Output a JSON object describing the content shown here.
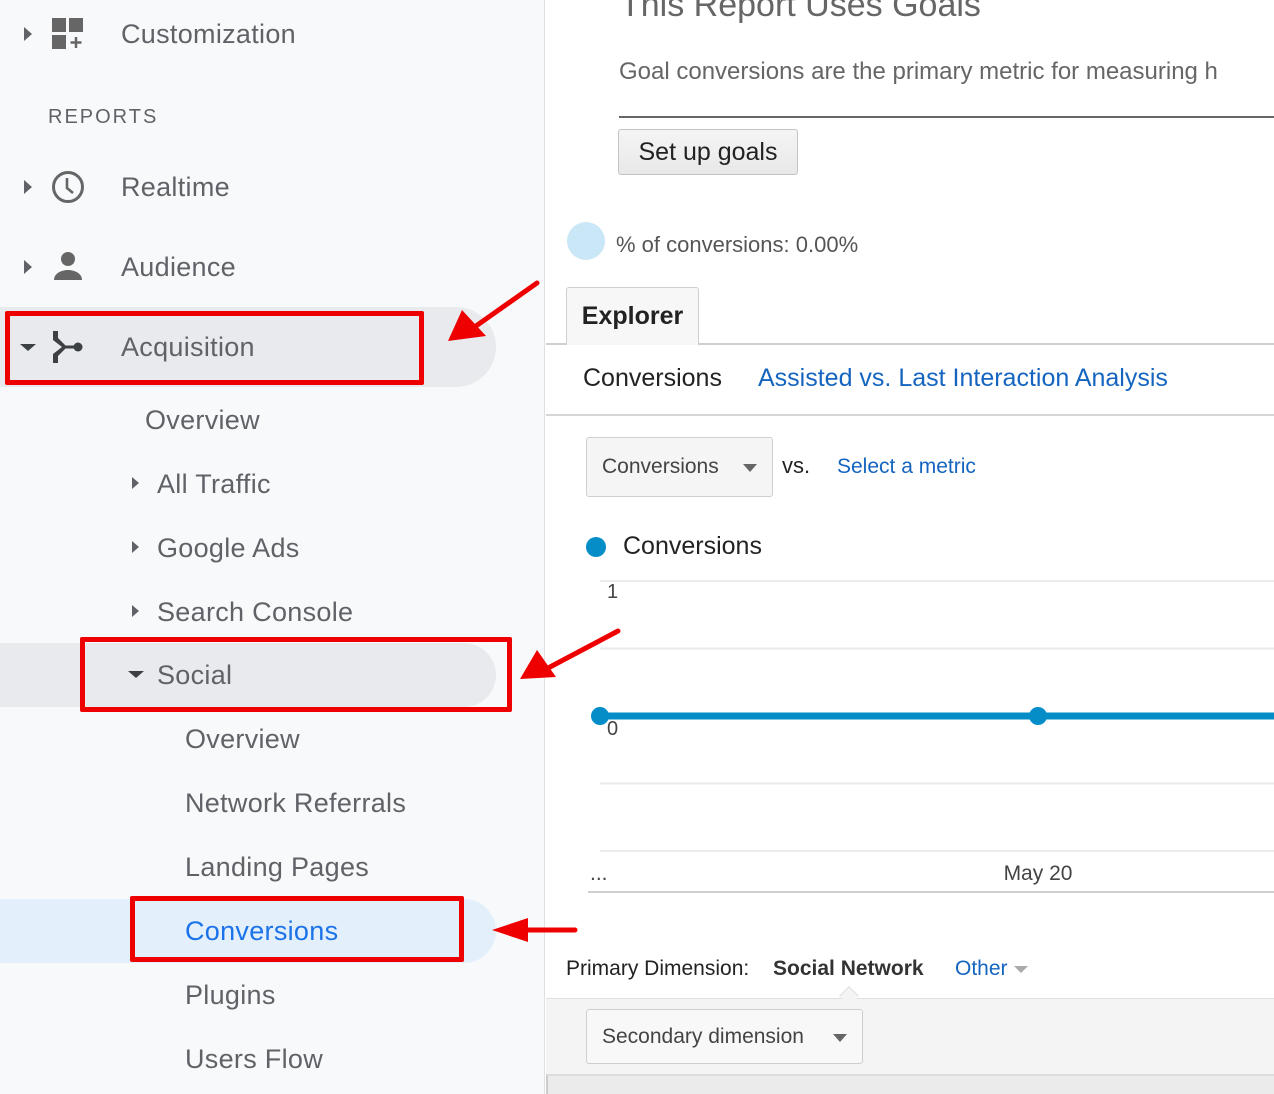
{
  "sidebar": {
    "customization": {
      "label": "Customization",
      "icon": "dashboard-plus-icon"
    },
    "section_header": "REPORTS",
    "top_items": [
      {
        "label": "Realtime",
        "icon": "clock-icon",
        "expanded": false
      },
      {
        "label": "Audience",
        "icon": "person-icon",
        "expanded": false
      },
      {
        "label": "Acquisition",
        "icon": "acquisition-fork-icon",
        "expanded": true
      }
    ],
    "acquisition_children": [
      {
        "label": "Overview",
        "has_caret": false
      },
      {
        "label": "All Traffic",
        "has_caret": true
      },
      {
        "label": "Google Ads",
        "has_caret": true
      },
      {
        "label": "Search Console",
        "has_caret": true
      },
      {
        "label": "Social",
        "has_caret": true,
        "expanded": true
      }
    ],
    "social_children": [
      {
        "label": "Overview"
      },
      {
        "label": "Network Referrals"
      },
      {
        "label": "Landing Pages"
      },
      {
        "label": "Conversions",
        "active": true
      },
      {
        "label": "Plugins"
      },
      {
        "label": "Users Flow"
      }
    ],
    "active_color": "#1a73e8"
  },
  "main": {
    "goals_notice": {
      "title": "This Report Uses Goals",
      "description": "Goal conversions are the primary metric for measuring h",
      "button_label": "Set up goals"
    },
    "percent_conversions": "% of conversions: 0.00%",
    "tabs": [
      {
        "label": "Explorer",
        "active": true
      }
    ],
    "subtabs": [
      {
        "label": "Conversions",
        "active": true
      },
      {
        "label": "Assisted vs. Last Interaction Analysis",
        "active": false
      }
    ],
    "metric_selector": {
      "value": "Conversions",
      "vs_label": "vs.",
      "select_metric_link": "Select a metric"
    },
    "primary_dimension": {
      "label": "Primary Dimension:",
      "value": "Social Network",
      "other_label": "Other"
    },
    "secondary_dimension": {
      "placeholder": "Secondary dimension"
    }
  },
  "chart_data": {
    "type": "line",
    "title": "",
    "legend": [
      {
        "name": "Conversions",
        "color": "#058dc7"
      }
    ],
    "legend_placement": "top-left",
    "x": [
      "...",
      "May 20",
      "..."
    ],
    "x_tick_labels": [
      "...",
      "May 20"
    ],
    "series": [
      {
        "name": "Conversions",
        "values": [
          0,
          0,
          0
        ],
        "color": "#058dc7"
      }
    ],
    "y_tick_labels": [
      "1",
      "0"
    ],
    "ylim": [
      -1,
      1
    ],
    "grid": true,
    "xlabel": "",
    "ylabel": ""
  },
  "annotations": {
    "color": "#ee0000",
    "highlighted": [
      "Acquisition",
      "Social",
      "Conversions"
    ]
  }
}
